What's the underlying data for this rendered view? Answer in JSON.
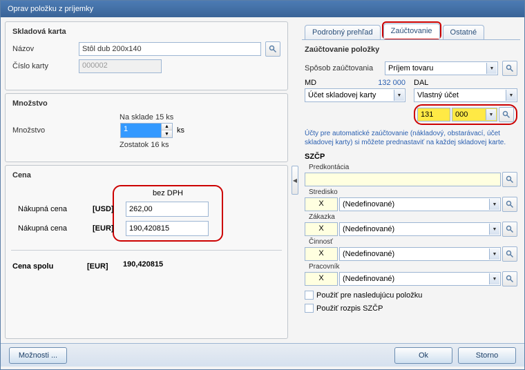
{
  "title": "Oprav položku z príjemky",
  "left": {
    "sklad": {
      "title": "Skladová karta",
      "nazov_label": "Názov",
      "nazov_value": "Stôl dub 200x140",
      "cislo_label": "Číslo karty",
      "cislo_placeholder": "000002"
    },
    "mnoz": {
      "title": "Množstvo",
      "na_sklade": "Na sklade  15 ks",
      "label": "Množstvo",
      "value": "1",
      "unit": "ks",
      "zostatok": "Zostatok  16 ks"
    },
    "cena": {
      "title": "Cena",
      "bez_dph": "bez DPH",
      "nakup_label": "Nákupná cena",
      "usd": "[USD]",
      "usd_val": "262,00",
      "eur": "[EUR]",
      "eur_val": "190,420815",
      "spolu_label": "Cena spolu",
      "spolu_cur": "[EUR]",
      "spolu_val": "190,420815"
    }
  },
  "right": {
    "tabs": [
      "Podrobný prehľad",
      "Zaúčtovanie",
      "Ostatné"
    ],
    "section_title": "Zaúčtovanie položky",
    "sposob_label": "Spôsob zaúčtovania",
    "sposob_value": "Príjem tovaru",
    "md_label": "MD",
    "md_num": "132 000",
    "md_select": "Účet skladovej karty",
    "dal_label": "DAL",
    "dal_select": "Vlastný účet",
    "dal_y1": "131",
    "dal_y2": "000",
    "hint": "Účty pre automatické zaúčtovanie (nákladový, obstarávací, účet skladovej karty) si môžete prednastaviť na každej skladovej karte.",
    "szcp_title": "SZČP",
    "szcp": [
      {
        "label": "Predkontácia",
        "x": "",
        "val": ""
      },
      {
        "label": "Stredisko",
        "x": "X",
        "val": "(Nedefinované)"
      },
      {
        "label": "Zákazka",
        "x": "X",
        "val": "(Nedefinované)"
      },
      {
        "label": "Činnosť",
        "x": "X",
        "val": "(Nedefinované)"
      },
      {
        "label": "Pracovník",
        "x": "X",
        "val": "(Nedefinované)"
      }
    ],
    "cb1": "Použiť pre nasledujúcu položku",
    "cb2": "Použiť rozpis SZČP"
  },
  "footer": {
    "moznosti": "Možnosti ...",
    "ok": "Ok",
    "storno": "Storno"
  }
}
